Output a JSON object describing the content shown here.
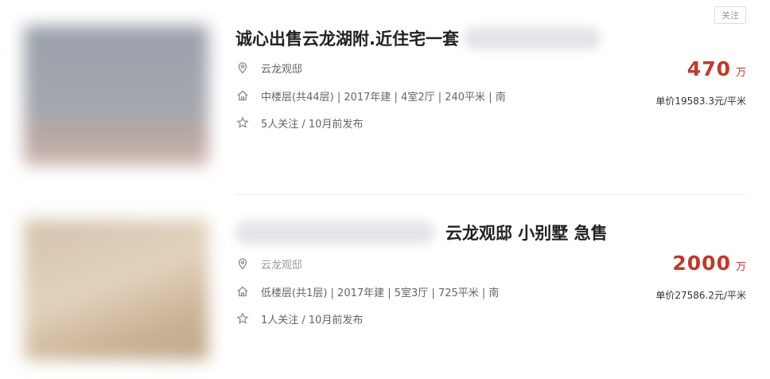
{
  "follow_button": "关注",
  "listings": [
    {
      "title": "诚心出售云龙湖附.近住宅一套",
      "location": "云龙观邸",
      "info": "中楼层(共44层) | 2017年建 | 4室2厅 | 240平米 | 南",
      "follow": "5人关注 / 10月前发布",
      "price": "470",
      "price_unit": "万",
      "unit_price": "单价19583.3元/平米"
    },
    {
      "title": "云龙观邸 小别墅 急售",
      "location": "云龙观邸",
      "info": "低楼层(共1层) | 2017年建 | 5室3厅 | 725平米 | 南",
      "follow": "1人关注 / 10月前发布",
      "price": "2000",
      "price_unit": "万",
      "unit_price": "单价27586.2元/平米"
    }
  ],
  "icons": {
    "location": "location-pin-icon",
    "house": "house-icon",
    "star": "star-icon"
  },
  "colors": {
    "price": "#c0392b",
    "title": "#222222",
    "meta": "#666666"
  }
}
